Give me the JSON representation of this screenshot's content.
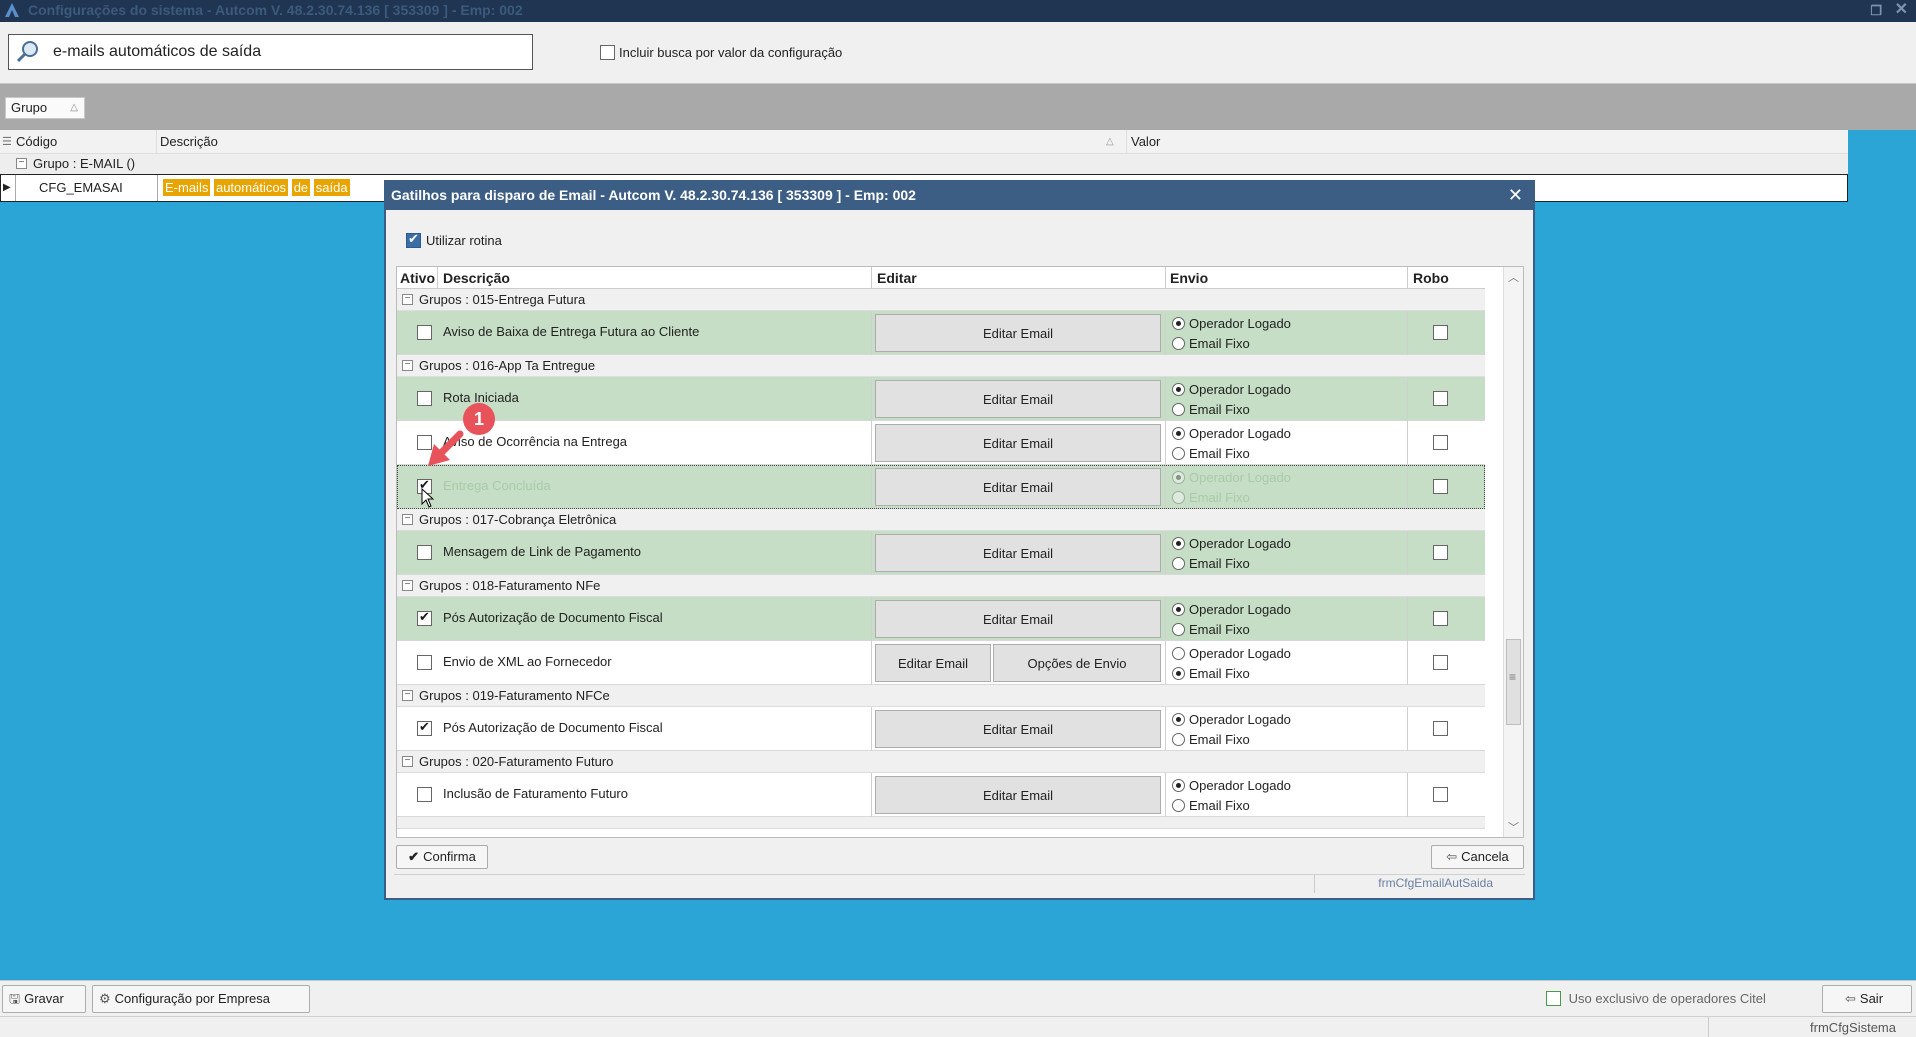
{
  "window": {
    "title": "Configurações do sistema   -   Autcom V. 48.2.30.74.136 [ 353309 ] - Emp: 002"
  },
  "search": {
    "value": "e-mails automáticos de saída",
    "include_value_label": "Incluir busca por valor da configuração"
  },
  "group_tag": {
    "label": "Grupo"
  },
  "grid": {
    "columns": {
      "code": "Código",
      "description": "Descrição",
      "value": "Valor"
    },
    "group_label": "Grupo : E-MAIL ()",
    "row": {
      "code": "CFG_EMASAI",
      "description_parts": [
        "E-mails",
        "automáticos",
        "de",
        "saída"
      ]
    }
  },
  "dialog": {
    "title": "Gatilhos para disparo de Email   -   Autcom V. 48.2.30.74.136 [ 353309 ] - Emp: 002",
    "utilizar_rotina": "Utilizar rotina",
    "columns": {
      "ativo": "Ativo",
      "descricao": "Descrição",
      "editar": "Editar",
      "envio": "Envio",
      "robo": "Robo"
    },
    "radio_labels": {
      "operador": "Operador Logado",
      "fixo": "Email Fixo"
    },
    "edit_label": "Editar Email",
    "options_label": "Opções de Envio",
    "groups": [
      {
        "label": "Grupos : 015-Entrega Futura",
        "rows": [
          {
            "desc": "Aviso de Baixa de Entrega Futura ao Cliente"
          }
        ]
      },
      {
        "label": "Grupos : 016-App Ta Entregue",
        "rows": [
          {
            "desc": "Rota Iniciada"
          },
          {
            "desc": "Aviso de Ocorrência na Entrega"
          },
          {
            "desc": "Entrega Concluída"
          }
        ]
      },
      {
        "label": "Grupos : 017-Cobrança Eletrônica",
        "rows": [
          {
            "desc": "Mensagem de Link de Pagamento"
          }
        ]
      },
      {
        "label": "Grupos : 018-Faturamento NFe",
        "rows": [
          {
            "desc": "Pós Autorização de Documento Fiscal"
          },
          {
            "desc": "Envio de XML ao Fornecedor"
          }
        ]
      },
      {
        "label": "Grupos : 019-Faturamento NFCe",
        "rows": [
          {
            "desc": "Pós Autorização de Documento Fiscal"
          }
        ]
      },
      {
        "label": "Grupos : 020-Faturamento Futuro",
        "rows": [
          {
            "desc": "Inclusão de Faturamento Futuro"
          }
        ]
      }
    ],
    "confirm_label": "Confirma",
    "cancel_label": "Cancela",
    "form_name": "frmCfgEmailAutSaida"
  },
  "annotation": {
    "step_number": "1"
  },
  "toolbar": {
    "save_label": "Gravar",
    "company_config_label": "Configuração por Empresa",
    "exclusive_label": "Uso exclusivo de operadores Citel",
    "exit_label": "Sair"
  },
  "status": {
    "form_name": "frmCfgSistema"
  },
  "colors": {
    "desktop": "#2aa5d6",
    "dialog_border": "#3d5e84",
    "row_green": "#c5dec5",
    "highlight": "#e8a500",
    "badge": "#e8525a"
  }
}
